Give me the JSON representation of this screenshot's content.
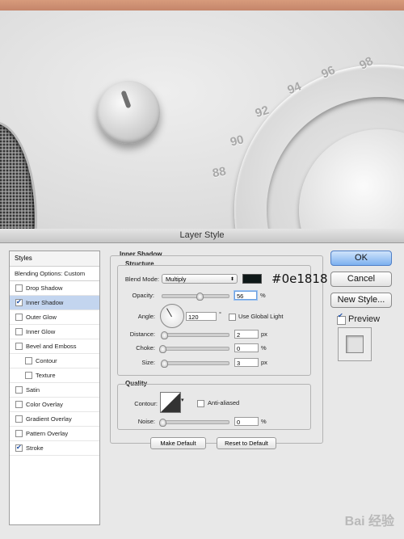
{
  "artwork": {
    "dial_numbers": [
      "88",
      "90",
      "92",
      "94",
      "96",
      "98"
    ]
  },
  "dialog": {
    "title": "Layer Style",
    "styles_panel": {
      "header": "Styles",
      "blending_options": "Blending Options: Custom",
      "items": [
        {
          "label": "Drop Shadow",
          "checked": false,
          "sub": false,
          "selected": false
        },
        {
          "label": "Inner Shadow",
          "checked": true,
          "sub": false,
          "selected": true
        },
        {
          "label": "Outer Glow",
          "checked": false,
          "sub": false,
          "selected": false
        },
        {
          "label": "Inner Glow",
          "checked": false,
          "sub": false,
          "selected": false
        },
        {
          "label": "Bevel and Emboss",
          "checked": false,
          "sub": false,
          "selected": false
        },
        {
          "label": "Contour",
          "checked": false,
          "sub": true,
          "selected": false
        },
        {
          "label": "Texture",
          "checked": false,
          "sub": true,
          "selected": false
        },
        {
          "label": "Satin",
          "checked": false,
          "sub": false,
          "selected": false
        },
        {
          "label": "Color Overlay",
          "checked": false,
          "sub": false,
          "selected": false
        },
        {
          "label": "Gradient Overlay",
          "checked": false,
          "sub": false,
          "selected": false
        },
        {
          "label": "Pattern Overlay",
          "checked": false,
          "sub": false,
          "selected": false
        },
        {
          "label": "Stroke",
          "checked": true,
          "sub": false,
          "selected": false
        }
      ]
    },
    "inner_shadow": {
      "section_title": "Inner Shadow",
      "structure": {
        "title": "Structure",
        "blend_mode_label": "Blend Mode:",
        "blend_mode_value": "Multiply",
        "color": "#0e1818",
        "color_annotation": "#0e1818",
        "opacity_label": "Opacity:",
        "opacity_value": "56",
        "opacity_unit": "%",
        "angle_label": "Angle:",
        "angle_value": "120",
        "angle_unit": "°",
        "use_global_light_label": "Use Global Light",
        "use_global_light": false,
        "distance_label": "Distance:",
        "distance_value": "2",
        "distance_unit": "px",
        "choke_label": "Choke:",
        "choke_value": "0",
        "choke_unit": "%",
        "size_label": "Size:",
        "size_value": "3",
        "size_unit": "px"
      },
      "quality": {
        "title": "Quality",
        "contour_label": "Contour:",
        "anti_aliased_label": "Anti-aliased",
        "anti_aliased": false,
        "noise_label": "Noise:",
        "noise_value": "0",
        "noise_unit": "%"
      },
      "make_default_label": "Make Default",
      "reset_default_label": "Reset to Default"
    },
    "buttons": {
      "ok": "OK",
      "cancel": "Cancel",
      "new_style": "New Style...",
      "preview_label": "Preview",
      "preview_checked": true
    }
  },
  "watermark": "Bai 经验"
}
